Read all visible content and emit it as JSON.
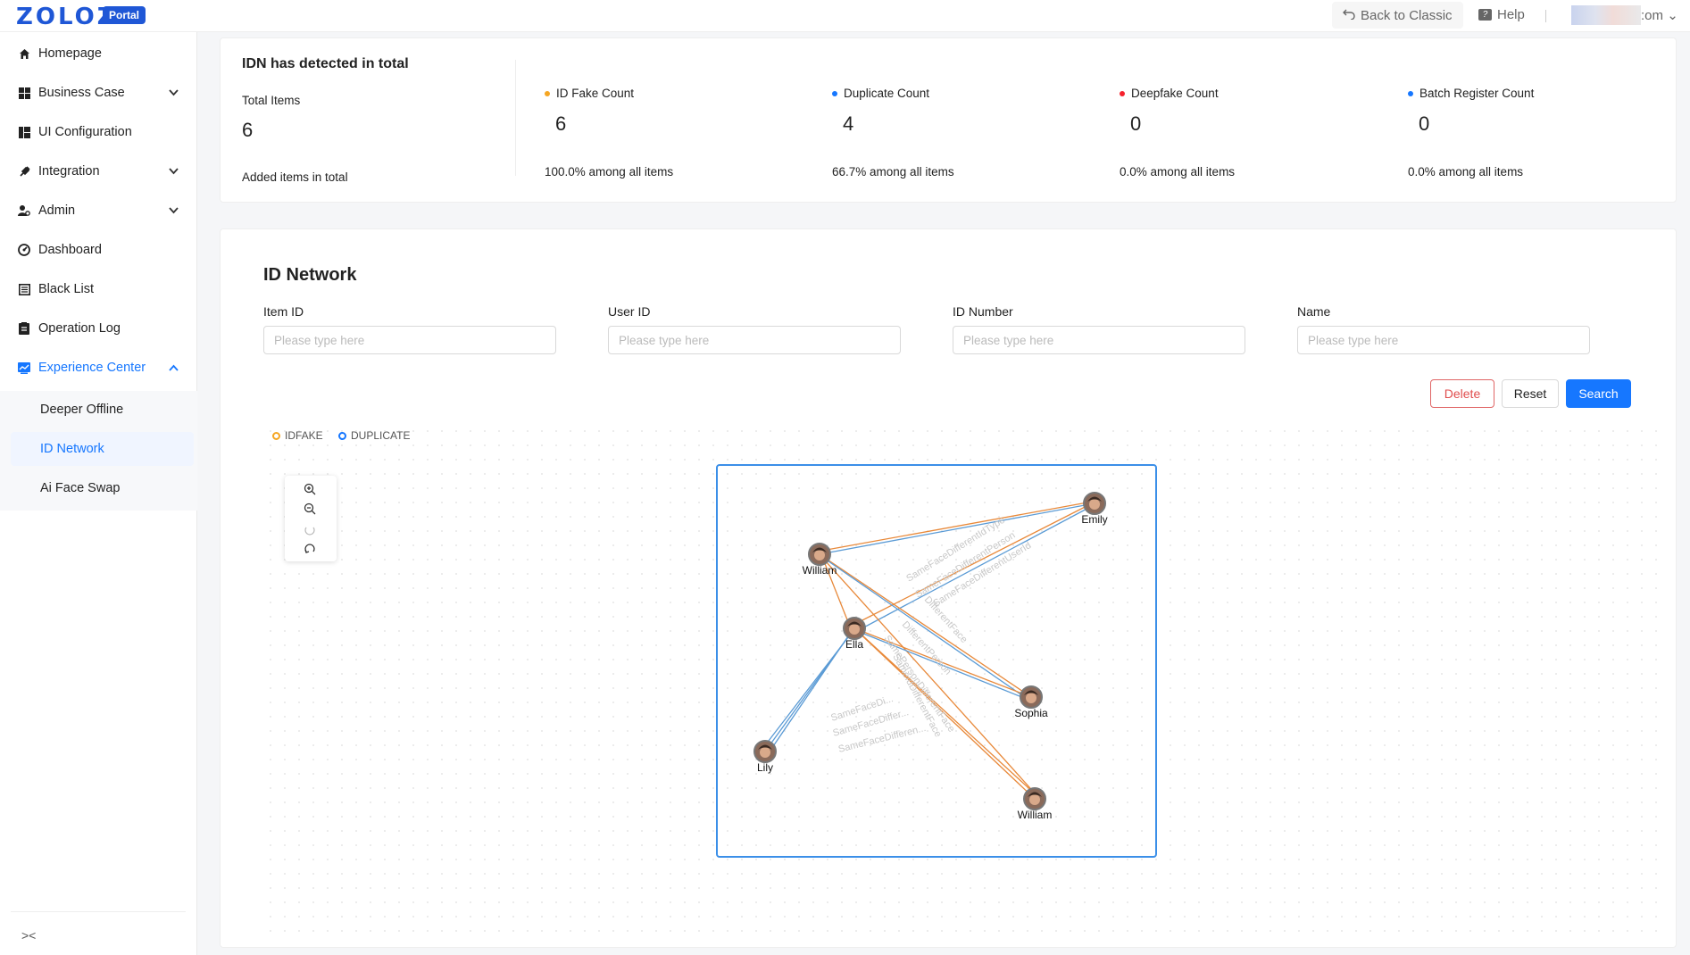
{
  "header": {
    "logo": "ZOLOZ",
    "badge": "Portal",
    "back_label": "Back to Classic",
    "help_label": "Help",
    "account_suffix": ":om"
  },
  "sidebar": {
    "items": [
      {
        "label": "Homepage",
        "icon": "home-icon"
      },
      {
        "label": "Business Case",
        "icon": "grid-icon"
      },
      {
        "label": "UI Configuration",
        "icon": "layout-icon"
      },
      {
        "label": "Integration",
        "icon": "plug-icon"
      },
      {
        "label": "Admin",
        "icon": "user-icon"
      },
      {
        "label": "Dashboard",
        "icon": "dashboard-icon"
      },
      {
        "label": "Black List",
        "icon": "blacklist-icon"
      },
      {
        "label": "Operation Log",
        "icon": "log-icon"
      },
      {
        "label": "Experience Center",
        "icon": "chart-icon"
      }
    ],
    "sub_items": [
      "Deeper Offline",
      "ID Network",
      "Ai Face Swap"
    ],
    "collapse_label": "><"
  },
  "stats": {
    "title": "IDN has detected in total",
    "total_label": "Total Items",
    "total_value": "6",
    "total_sub": "Added items in total",
    "metrics": [
      {
        "label": "ID Fake Count",
        "value": "6",
        "pct": "100.0% among all items",
        "color": "#f5a623"
      },
      {
        "label": "Duplicate Count",
        "value": "4",
        "pct": "66.7% among all items",
        "color": "#1677ff"
      },
      {
        "label": "Deepfake Count",
        "value": "0",
        "pct": "0.0% among all items",
        "color": "#f5222d"
      },
      {
        "label": "Batch Register Count",
        "value": "0",
        "pct": "0.0% among all items",
        "color": "#1677ff"
      }
    ]
  },
  "network": {
    "title": "ID Network",
    "fields": [
      {
        "label": "Item ID",
        "placeholder": "Please type here"
      },
      {
        "label": "User ID",
        "placeholder": "Please type here"
      },
      {
        "label": "ID Number",
        "placeholder": "Please type here"
      },
      {
        "label": "Name",
        "placeholder": "Please type here"
      }
    ],
    "buttons": {
      "delete": "Delete",
      "reset": "Reset",
      "search": "Search"
    },
    "legend": [
      {
        "label": "IDFAKE",
        "color": "#f5a623"
      },
      {
        "label": "DUPLICATE",
        "color": "#1677ff"
      }
    ],
    "nodes": [
      {
        "name": "Emily"
      },
      {
        "name": "William"
      },
      {
        "name": "Ella"
      },
      {
        "name": "Sophia"
      },
      {
        "name": "Lily"
      },
      {
        "name": "William"
      }
    ],
    "edge_labels": [
      "SameFaceDifferentIdType",
      "SameFaceDifferentPerson",
      "SameFaceDifferentUserId",
      "DifferentFace",
      "SameIdDifferentFace",
      "SamePersonDifferentFace",
      "DifferentPerson",
      "SameFaceDi...",
      "SameFaceDiffer...",
      "SameFaceDifferen..."
    ],
    "edge_colors": {
      "idfake": "#e8893a",
      "duplicate": "#5b9bd5"
    }
  }
}
